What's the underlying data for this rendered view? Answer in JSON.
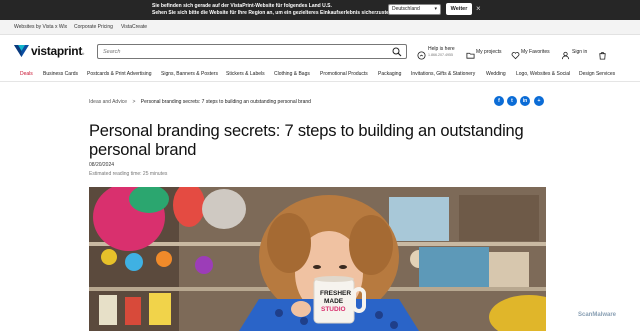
{
  "banner": {
    "line1": "Sie befinden sich gerade auf der VistaPrint-Website für folgendes Land U.S.",
    "line2": "Sehen Sie sich bitte die Website für Ihre Region an, um ein gezielteres Einkaufserlebnis sicherzustellen.",
    "country_select": "Deutschland",
    "confirm_label": "Weiter",
    "close_icon": "×"
  },
  "utility": {
    "items": [
      "Websites by Vista x Wix",
      "Corporate Pricing",
      "VistaCreate"
    ]
  },
  "header": {
    "logo_text": "vistaprint",
    "search_placeholder": "Search",
    "help_label": "Help is here",
    "help_phone": "1.866.207.4955",
    "projects_label": "My projects",
    "favorites_label": "My Favorites",
    "signin_label": "Sign in"
  },
  "categories": [
    "Deals",
    "Business Cards",
    "Postcards & Print Advertising",
    "Signs, Banners & Posters",
    "Stickers & Labels",
    "Clothing & Bags",
    "Promotional Products",
    "Packaging",
    "Invitations, Gifts & Stationery",
    "Wedding",
    "Logo, Websites & Social",
    "Design Services"
  ],
  "breadcrumb": {
    "parent": "Ideas and Advice",
    "separator": ">",
    "current": "Personal branding secrets: 7 steps to building an outstanding personal brand"
  },
  "share": {
    "facebook": "f",
    "twitter": "t",
    "linkedin": "in",
    "more": "+"
  },
  "article": {
    "title": "Personal branding secrets: 7 steps to building an outstanding personal brand",
    "date": "08/20/2024",
    "reading_time": "Estimated reading time: 25 minutes",
    "mug_text_1": "FRESHER",
    "mug_text_2": "MADE",
    "mug_text_3": "STUDIO"
  },
  "watermark": "ScanMalware",
  "colors": {
    "accent_blue": "#0b6cd6",
    "deals_red": "#c8102e",
    "banner_bg": "#262626"
  }
}
